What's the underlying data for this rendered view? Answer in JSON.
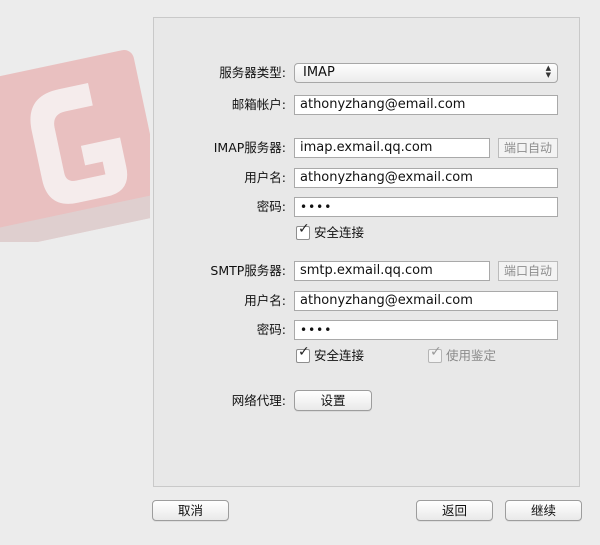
{
  "form": {
    "server_type_label": "服务器类型:",
    "server_type_value": "IMAP",
    "account_label": "邮箱帐户:",
    "account_value": "athonyzhang@email.com",
    "imap": {
      "server_label": "IMAP服务器:",
      "server_value": "imap.exmail.qq.com",
      "auto_port_label": "端口自动",
      "username_label": "用户名:",
      "username_value": "athonyzhang@exmail.com",
      "password_label": "密码:",
      "password_value": "••••",
      "secure_label": "安全连接",
      "secure_checked": true
    },
    "smtp": {
      "server_label": "SMTP服务器:",
      "server_value": "smtp.exmail.qq.com",
      "auto_port_label": "端口自动",
      "username_label": "用户名:",
      "username_value": "athonyzhang@exmail.com",
      "password_label": "密码:",
      "password_value": "••••",
      "secure_label": "安全连接",
      "secure_checked": true,
      "auth_label": "使用鉴定",
      "auth_checked": true
    },
    "proxy_label": "网络代理:",
    "proxy_button": "设置"
  },
  "footer": {
    "cancel_label": "取消",
    "back_label": "返回",
    "continue_label": "继续"
  },
  "colors": {
    "logo_fill": "#e9b9b9",
    "background": "#ececec",
    "panel": "#e8e8e8"
  }
}
